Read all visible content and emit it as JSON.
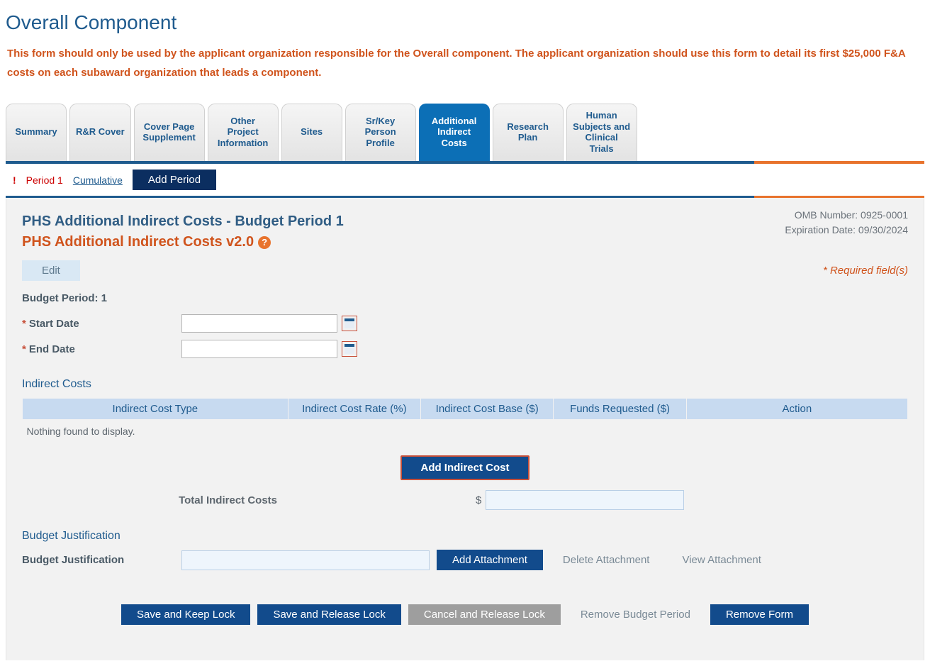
{
  "page_title": "Overall Component",
  "instruction": "This form should only be used by the applicant organization responsible for the Overall component.  The applicant organization should use this form to detail its first $25,000 F&A costs on each subaward organization that leads a component.",
  "tabs": [
    "Summary",
    "R&R Cover",
    "Cover Page Supplement",
    "Other Project Information",
    "Sites",
    "Sr/Key Person Profile",
    "Additional Indirect Costs",
    "Research Plan",
    "Human Subjects and Clinical Trials"
  ],
  "period_bar": {
    "period1": "Period 1",
    "cumulative": "Cumulative",
    "add_period": "Add Period"
  },
  "form": {
    "heading": "PHS Additional Indirect Costs - Budget Period 1",
    "subheading": "PHS Additional Indirect Costs v2.0",
    "omb_number_label": "OMB Number: 0925-0001",
    "expiration_label": "Expiration Date: 09/30/2024",
    "edit": "Edit",
    "required_note": "* Required field(s)",
    "budget_period_label": "Budget Period: 1",
    "start_date_label": "Start Date",
    "end_date_label": "End Date",
    "start_date_value": "",
    "end_date_value": "",
    "indirect_costs_title": "Indirect Costs",
    "cols": {
      "type": "Indirect Cost Type",
      "rate": "Indirect Cost Rate (%)",
      "base": "Indirect Cost Base ($)",
      "funds": "Funds Requested ($)",
      "action": "Action"
    },
    "empty_msg": "Nothing found to display.",
    "add_indirect": "Add Indirect Cost",
    "total_label": "Total Indirect Costs",
    "total_currency": "$",
    "total_value": "",
    "bj_section": "Budget Justification",
    "bj_label": "Budget Justification",
    "bj_value": "",
    "add_attachment": "Add Attachment",
    "delete_attachment": "Delete Attachment",
    "view_attachment": "View Attachment"
  },
  "footer": {
    "save_keep": "Save and Keep Lock",
    "save_release": "Save and Release Lock",
    "cancel_release": "Cancel and Release Lock",
    "remove_period": "Remove Budget Period",
    "remove_form": "Remove Form"
  }
}
